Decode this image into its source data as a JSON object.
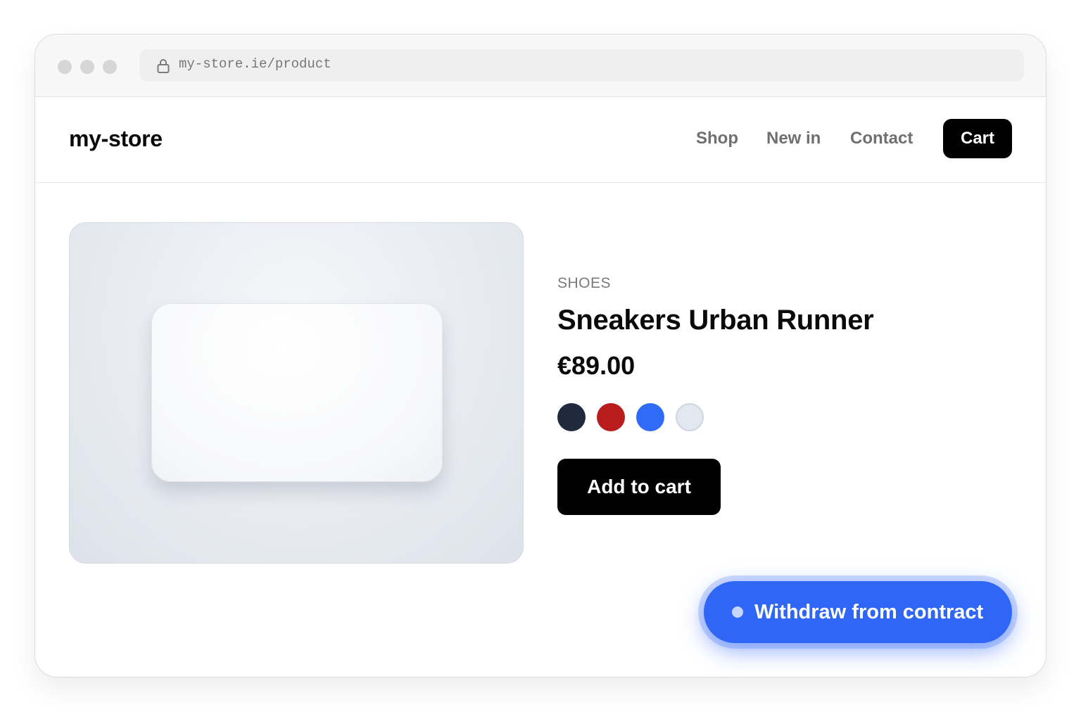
{
  "browser": {
    "url": "my-store.ie/product",
    "lock_icon": "lock-icon",
    "window_controls": [
      "close",
      "minimize",
      "maximize"
    ]
  },
  "header": {
    "brand": "my-store",
    "nav": [
      {
        "label": "Shop"
      },
      {
        "label": "New in"
      },
      {
        "label": "Contact"
      }
    ],
    "cart_label": "Cart"
  },
  "product": {
    "category": "SHOES",
    "title": "Sneakers Urban Runner",
    "price": "€89.00",
    "colors": [
      "#1f2a3d",
      "#b91c1c",
      "#2f6bf6",
      "#e2e8f0"
    ],
    "add_to_cart_label": "Add to cart"
  },
  "floating_action": {
    "label": "Withdraw from contract",
    "accent": "#2f66f6"
  }
}
